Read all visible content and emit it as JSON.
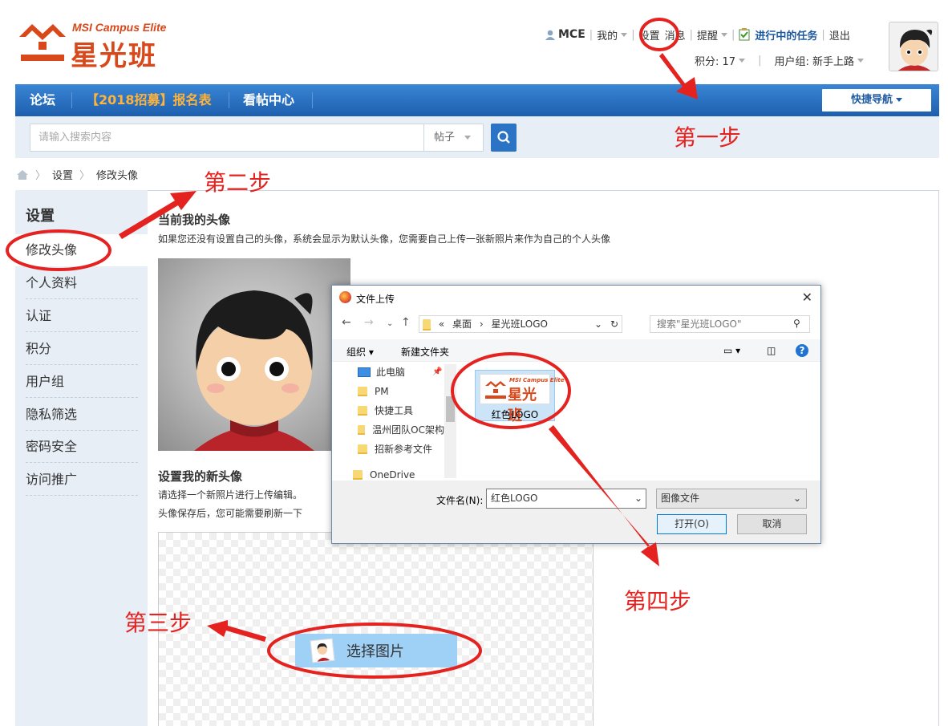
{
  "logo": {
    "en": "MSI Campus Elite",
    "cn": "星光班"
  },
  "topnav": {
    "user": "MCE",
    "mine": "我的",
    "settings": "设置",
    "messages": "消息",
    "reminders": "提醒",
    "tasks": "进行中的任务",
    "logout": "退出",
    "points": "积分: 17",
    "usergroup": "用户组: 新手上路"
  },
  "navbar": {
    "items": [
      "论坛",
      "【2018招募】报名表",
      "看帖中心"
    ],
    "quicknav": "快捷导航"
  },
  "search": {
    "placeholder": "请输入搜索内容",
    "type": "帖子"
  },
  "breadcrumb": [
    "设置",
    "修改头像"
  ],
  "sidebar": {
    "title": "设置",
    "items": [
      "修改头像",
      "个人资料",
      "认证",
      "积分",
      "用户组",
      "隐私筛选",
      "密码安全",
      "访问推广"
    ],
    "active": "修改头像"
  },
  "main": {
    "current_title": "当前我的头像",
    "current_desc": "如果您还没有设置自己的头像，系统会显示为默认头像，您需要自己上传一张新照片来作为自己的个人头像",
    "new_title": "设置我的新头像",
    "new_desc1": "请选择一个新照片进行上传编辑。",
    "new_desc2": "头像保存后，您可能需要刷新一下",
    "pick_button": "选择图片"
  },
  "dialog": {
    "title": "文件上传",
    "path": [
      "«",
      "桌面",
      "星光班LOGO"
    ],
    "search_placeholder": "搜索\"星光班LOGO\"",
    "organize": "组织",
    "new_folder": "新建文件夹",
    "tree": [
      "此电脑",
      "PM",
      "快捷工具",
      "温州团队OC架构",
      "招新参考文件",
      "OneDrive"
    ],
    "file": {
      "name": "红色LOGO",
      "thumb_en": "MSI Campus Elite",
      "thumb_cn": "星光班"
    },
    "filename_label": "文件名(N):",
    "filename_value": "红色LOGO",
    "filetype": "图像文件",
    "open": "打开(O)",
    "cancel": "取消"
  },
  "annotations": [
    "第一步",
    "第二步",
    "第三步",
    "第四步"
  ],
  "colors": {
    "brand": "#d9481b",
    "nav_blue": "#2a73c5",
    "annotation_red": "#e42320"
  }
}
